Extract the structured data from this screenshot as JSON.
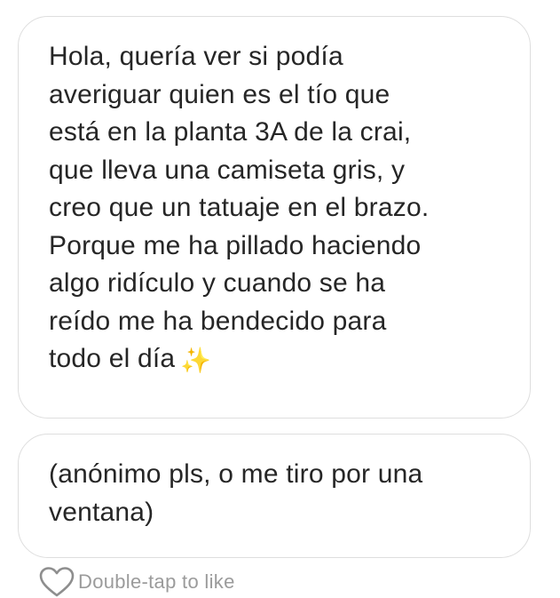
{
  "messages": [
    {
      "text": "Hola, quería ver si podía\naveriguar quien es el tío que\nestá en la planta 3A de la crai,\nque lleva una camiseta gris, y\ncreo que un tatuaje en el brazo.\nPorque me ha pillado haciendo\nalgo ridículo y cuando se ha\nreído me ha bendecido para\ntodo el día",
      "emoji": "✨",
      "emoji_icon": "sparkles-icon"
    },
    {
      "text": "(anónimo pls, o me tiro por una\nventana)"
    }
  ],
  "like_hint": {
    "icon": "heart-outline-icon",
    "label": "Double-tap to like"
  },
  "colors": {
    "text": "#262626",
    "bubble_border": "#dedede",
    "hint_text": "#9b9b9b",
    "sparkles": "#f2c12e"
  }
}
